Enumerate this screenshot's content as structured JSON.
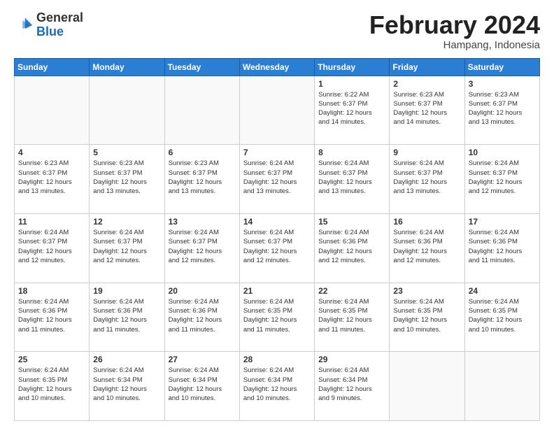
{
  "header": {
    "logo": {
      "general": "General",
      "blue": "Blue"
    },
    "title": "February 2024",
    "location": "Hampang, Indonesia"
  },
  "weekdays": [
    "Sunday",
    "Monday",
    "Tuesday",
    "Wednesday",
    "Thursday",
    "Friday",
    "Saturday"
  ],
  "weeks": [
    [
      {
        "day": "",
        "info": ""
      },
      {
        "day": "",
        "info": ""
      },
      {
        "day": "",
        "info": ""
      },
      {
        "day": "",
        "info": ""
      },
      {
        "day": "1",
        "info": "Sunrise: 6:22 AM\nSunset: 6:37 PM\nDaylight: 12 hours\nand 14 minutes."
      },
      {
        "day": "2",
        "info": "Sunrise: 6:23 AM\nSunset: 6:37 PM\nDaylight: 12 hours\nand 14 minutes."
      },
      {
        "day": "3",
        "info": "Sunrise: 6:23 AM\nSunset: 6:37 PM\nDaylight: 12 hours\nand 13 minutes."
      }
    ],
    [
      {
        "day": "4",
        "info": "Sunrise: 6:23 AM\nSunset: 6:37 PM\nDaylight: 12 hours\nand 13 minutes."
      },
      {
        "day": "5",
        "info": "Sunrise: 6:23 AM\nSunset: 6:37 PM\nDaylight: 12 hours\nand 13 minutes."
      },
      {
        "day": "6",
        "info": "Sunrise: 6:23 AM\nSunset: 6:37 PM\nDaylight: 12 hours\nand 13 minutes."
      },
      {
        "day": "7",
        "info": "Sunrise: 6:24 AM\nSunset: 6:37 PM\nDaylight: 12 hours\nand 13 minutes."
      },
      {
        "day": "8",
        "info": "Sunrise: 6:24 AM\nSunset: 6:37 PM\nDaylight: 12 hours\nand 13 minutes."
      },
      {
        "day": "9",
        "info": "Sunrise: 6:24 AM\nSunset: 6:37 PM\nDaylight: 12 hours\nand 13 minutes."
      },
      {
        "day": "10",
        "info": "Sunrise: 6:24 AM\nSunset: 6:37 PM\nDaylight: 12 hours\nand 12 minutes."
      }
    ],
    [
      {
        "day": "11",
        "info": "Sunrise: 6:24 AM\nSunset: 6:37 PM\nDaylight: 12 hours\nand 12 minutes."
      },
      {
        "day": "12",
        "info": "Sunrise: 6:24 AM\nSunset: 6:37 PM\nDaylight: 12 hours\nand 12 minutes."
      },
      {
        "day": "13",
        "info": "Sunrise: 6:24 AM\nSunset: 6:37 PM\nDaylight: 12 hours\nand 12 minutes."
      },
      {
        "day": "14",
        "info": "Sunrise: 6:24 AM\nSunset: 6:37 PM\nDaylight: 12 hours\nand 12 minutes."
      },
      {
        "day": "15",
        "info": "Sunrise: 6:24 AM\nSunset: 6:36 PM\nDaylight: 12 hours\nand 12 minutes."
      },
      {
        "day": "16",
        "info": "Sunrise: 6:24 AM\nSunset: 6:36 PM\nDaylight: 12 hours\nand 12 minutes."
      },
      {
        "day": "17",
        "info": "Sunrise: 6:24 AM\nSunset: 6:36 PM\nDaylight: 12 hours\nand 11 minutes."
      }
    ],
    [
      {
        "day": "18",
        "info": "Sunrise: 6:24 AM\nSunset: 6:36 PM\nDaylight: 12 hours\nand 11 minutes."
      },
      {
        "day": "19",
        "info": "Sunrise: 6:24 AM\nSunset: 6:36 PM\nDaylight: 12 hours\nand 11 minutes."
      },
      {
        "day": "20",
        "info": "Sunrise: 6:24 AM\nSunset: 6:36 PM\nDaylight: 12 hours\nand 11 minutes."
      },
      {
        "day": "21",
        "info": "Sunrise: 6:24 AM\nSunset: 6:35 PM\nDaylight: 12 hours\nand 11 minutes."
      },
      {
        "day": "22",
        "info": "Sunrise: 6:24 AM\nSunset: 6:35 PM\nDaylight: 12 hours\nand 11 minutes."
      },
      {
        "day": "23",
        "info": "Sunrise: 6:24 AM\nSunset: 6:35 PM\nDaylight: 12 hours\nand 10 minutes."
      },
      {
        "day": "24",
        "info": "Sunrise: 6:24 AM\nSunset: 6:35 PM\nDaylight: 12 hours\nand 10 minutes."
      }
    ],
    [
      {
        "day": "25",
        "info": "Sunrise: 6:24 AM\nSunset: 6:35 PM\nDaylight: 12 hours\nand 10 minutes."
      },
      {
        "day": "26",
        "info": "Sunrise: 6:24 AM\nSunset: 6:34 PM\nDaylight: 12 hours\nand 10 minutes."
      },
      {
        "day": "27",
        "info": "Sunrise: 6:24 AM\nSunset: 6:34 PM\nDaylight: 12 hours\nand 10 minutes."
      },
      {
        "day": "28",
        "info": "Sunrise: 6:24 AM\nSunset: 6:34 PM\nDaylight: 12 hours\nand 10 minutes."
      },
      {
        "day": "29",
        "info": "Sunrise: 6:24 AM\nSunset: 6:34 PM\nDaylight: 12 hours\nand 9 minutes."
      },
      {
        "day": "",
        "info": ""
      },
      {
        "day": "",
        "info": ""
      }
    ]
  ]
}
